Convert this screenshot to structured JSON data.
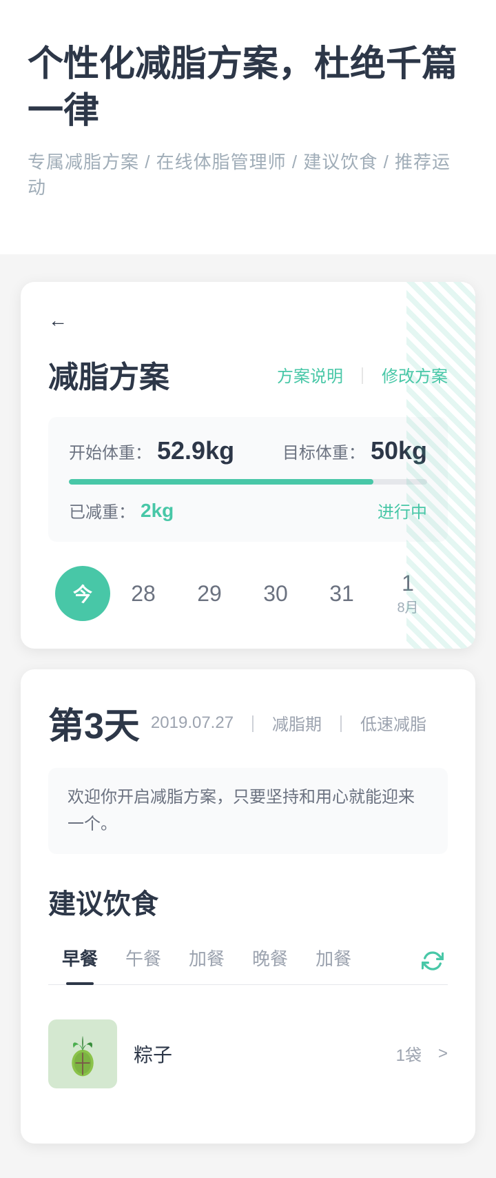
{
  "header": {
    "main_title": "个性化减脂方案，杜绝千篇一律",
    "sub_title": "专属减脂方案 / 在线体脂管理师 / 建议饮食 / 推荐运动"
  },
  "plan_card": {
    "back_icon": "←",
    "title": "减脂方案",
    "action_explain": "方案说明",
    "action_divider": "｜",
    "action_modify": "修改方案",
    "start_weight_label": "开始体重：",
    "start_weight_value": "52.9kg",
    "target_weight_label": "目标体重：",
    "target_weight_value": "50kg",
    "progress_percent": 85,
    "lost_label": "已减重：",
    "lost_value": "2kg",
    "status": "进行中"
  },
  "date_selector": {
    "today_label": "今",
    "dates": [
      "28",
      "29",
      "30",
      "31"
    ],
    "special_date": "1",
    "special_month": "8月"
  },
  "day_detail": {
    "day_number": "第3天",
    "date": "2019.07.27",
    "separator1": "｜",
    "tag1": "减脂期",
    "separator2": "｜",
    "tag2": "低速减脂",
    "message": "欢迎你开启减脂方案，只要坚持和用心就能迎来一个。"
  },
  "diet_section": {
    "title": "建议饮食",
    "tabs": [
      {
        "label": "早餐",
        "active": true
      },
      {
        "label": "午餐",
        "active": false
      },
      {
        "label": "加餐",
        "active": false
      },
      {
        "label": "晚餐",
        "active": false
      },
      {
        "label": "加餐",
        "active": false
      }
    ],
    "refresh_icon": "↺",
    "food_items": [
      {
        "name": "粽子",
        "amount": "1袋",
        "arrow": ">"
      }
    ]
  },
  "colors": {
    "accent": "#48c7a7",
    "text_dark": "#2d3748",
    "text_gray": "#9ca3af",
    "bg_light": "#f9fafb"
  }
}
